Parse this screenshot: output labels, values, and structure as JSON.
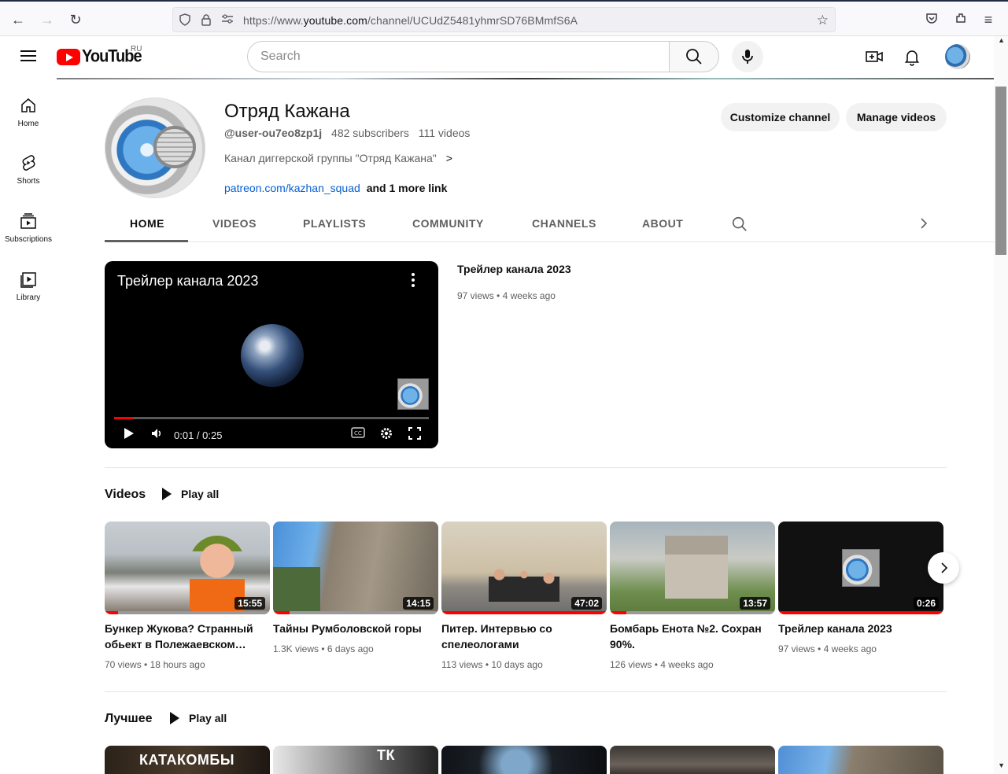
{
  "browser": {
    "url_prefix": "https://www.",
    "url_domain": "youtube.com",
    "url_path": "/channel/UCUdZ5481yhmrSD76BMmfS6A"
  },
  "masthead": {
    "logo_text": "YouTube",
    "country": "RU",
    "search_placeholder": "Search"
  },
  "guide": [
    {
      "label": "Home",
      "icon": "home-icon"
    },
    {
      "label": "Shorts",
      "icon": "shorts-icon"
    },
    {
      "label": "Subscriptions",
      "icon": "subscriptions-icon"
    },
    {
      "label": "Library",
      "icon": "library-icon"
    }
  ],
  "channel": {
    "name": "Отряд Кажана",
    "handle": "@user-ou7eo8zp1j",
    "subscribers": "482 subscribers",
    "videos": "111 videos",
    "description": "Канал диггерской группы \"Отряд Кажана\"",
    "link": "patreon.com/kazhan_squad",
    "more_links": "and 1 more link",
    "customize_label": "Customize channel",
    "manage_label": "Manage videos"
  },
  "tabs": [
    {
      "label": "HOME",
      "active": true
    },
    {
      "label": "VIDEOS",
      "active": false
    },
    {
      "label": "PLAYLISTS",
      "active": false
    },
    {
      "label": "COMMUNITY",
      "active": false
    },
    {
      "label": "CHANNELS",
      "active": false
    },
    {
      "label": "ABOUT",
      "active": false
    }
  ],
  "trailer": {
    "title": "Трейлер канала 2023",
    "time": "0:01 / 0:25",
    "progress": 0.06,
    "info_title": "Трейлер канала 2023",
    "views": "97 views",
    "age": "4 weeks ago"
  },
  "shelf_videos": {
    "title": "Videos",
    "play_all": "Play all",
    "items": [
      {
        "title": "Бункер Жукова? Странный обьект в Полежаевском…",
        "views": "70 views",
        "age": "18 hours ago",
        "duration": "15:55",
        "watched": 0.08
      },
      {
        "title": "Тайны Румболовской горы",
        "views": "1.3K views",
        "age": "6 days ago",
        "duration": "14:15",
        "watched": 0.1
      },
      {
        "title": "Питер. Интервью со спелеологами",
        "views": "113 views",
        "age": "10 days ago",
        "duration": "47:02",
        "watched": 1.0
      },
      {
        "title": "Бомбарь Енота №2. Сохран 90%.",
        "views": "126 views",
        "age": "4 weeks ago",
        "duration": "13:57",
        "watched": 0.1
      },
      {
        "title": "Трейлер канала 2023",
        "views": "97 views",
        "age": "4 weeks ago",
        "duration": "0:26",
        "watched": 1.0
      }
    ]
  },
  "shelf_best": {
    "title": "Лучшее",
    "play_all": "Play all",
    "captions": [
      "КАТАКОМБЫ",
      "ТК",
      "",
      "",
      ""
    ]
  },
  "colors": {
    "accent_red": "#ff0000",
    "link_blue": "#065fd4"
  }
}
